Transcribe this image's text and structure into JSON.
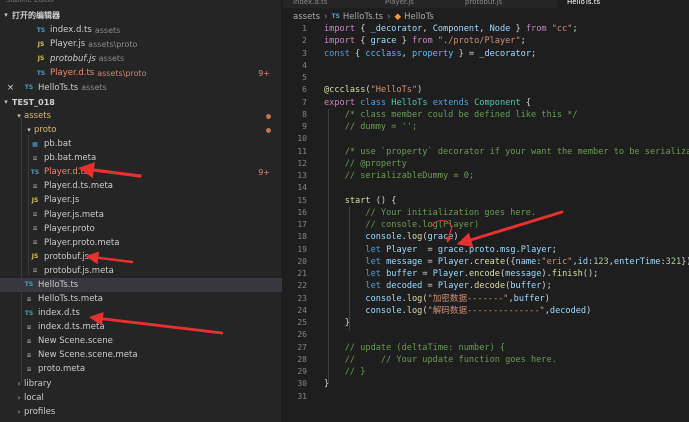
{
  "title_bar": {
    "text": "Subline Editor"
  },
  "sidebar": {
    "open_editors_label": "打开的编辑器",
    "open_editors": [
      {
        "icon": "TS",
        "name": "index.d.ts",
        "dir": "assets",
        "state": "normal"
      },
      {
        "icon": "JS",
        "name": "Player.js",
        "dir": "assets\\proto",
        "state": "normal"
      },
      {
        "icon": "JS",
        "name": "protobuf.js",
        "dir": "assets",
        "state": "normal",
        "italic": true
      },
      {
        "icon": "TS",
        "name": "Player.d.ts",
        "dir": "assets\\proto",
        "state": "error",
        "badge": "9+"
      },
      {
        "icon": "TS",
        "name": "HelloTs.ts",
        "dir": "assets",
        "state": "active",
        "close": "×"
      }
    ],
    "project_label": "TEST_018",
    "tree": [
      {
        "indent": 1,
        "type": "folder",
        "name": "assets",
        "open": true,
        "state": "modified",
        "dot": true
      },
      {
        "indent": 2,
        "type": "folder",
        "name": "proto",
        "open": true,
        "state": "modified",
        "dot": true
      },
      {
        "indent": 3,
        "type": "file",
        "icon": "BAT",
        "name": "pb.bat"
      },
      {
        "indent": 3,
        "type": "file",
        "icon": "META",
        "name": "pb.bat.meta"
      },
      {
        "indent": 3,
        "type": "file",
        "icon": "TS",
        "name": "Player.d.ts",
        "state": "error",
        "badge": "9+"
      },
      {
        "indent": 3,
        "type": "file",
        "icon": "META",
        "name": "Player.d.ts.meta"
      },
      {
        "indent": 3,
        "type": "file",
        "icon": "JS",
        "name": "Player.js"
      },
      {
        "indent": 3,
        "type": "file",
        "icon": "META",
        "name": "Player.js.meta"
      },
      {
        "indent": 3,
        "type": "file",
        "icon": "PROTO",
        "name": "Player.proto"
      },
      {
        "indent": 3,
        "type": "file",
        "icon": "META",
        "name": "Player.proto.meta"
      },
      {
        "indent": 3,
        "type": "file",
        "icon": "JS",
        "name": "protobuf.js"
      },
      {
        "indent": 3,
        "type": "file",
        "icon": "META",
        "name": "protobuf.js.meta"
      },
      {
        "indent": 2,
        "type": "file",
        "icon": "TS",
        "name": "HelloTs.ts",
        "selected": true
      },
      {
        "indent": 2,
        "type": "file",
        "icon": "META",
        "name": "HelloTs.ts.meta"
      },
      {
        "indent": 2,
        "type": "file",
        "icon": "TS",
        "name": "index.d.ts"
      },
      {
        "indent": 2,
        "type": "file",
        "icon": "META",
        "name": "index.d.ts.meta"
      },
      {
        "indent": 2,
        "type": "file",
        "icon": "SCENE",
        "name": "New Scene.scene"
      },
      {
        "indent": 2,
        "type": "file",
        "icon": "META",
        "name": "New Scene.scene.meta"
      },
      {
        "indent": 2,
        "type": "file",
        "icon": "META",
        "name": "proto.meta"
      },
      {
        "indent": 1,
        "type": "folder",
        "name": "library",
        "open": false
      },
      {
        "indent": 1,
        "type": "folder",
        "name": "local",
        "open": false
      },
      {
        "indent": 1,
        "type": "folder",
        "name": "profiles",
        "open": false
      }
    ]
  },
  "tabs": [
    {
      "label": "index.d.ts",
      "active": false
    },
    {
      "label": "Player.js",
      "active": false
    },
    {
      "label": "protobuf.js",
      "active": false
    },
    {
      "label": "HelloTs.ts",
      "active": true
    }
  ],
  "breadcrumb": {
    "folder": "assets",
    "file": "HelloTs.ts",
    "symbol": "HelloTs"
  },
  "code_lines": [
    [
      [
        "k",
        "import"
      ],
      [
        "p",
        " { "
      ],
      [
        "v",
        "_decorator"
      ],
      [
        "p",
        ", "
      ],
      [
        "v",
        "Component"
      ],
      [
        "p",
        ", "
      ],
      [
        "v",
        "Node"
      ],
      [
        "p",
        " } "
      ],
      [
        "k",
        "from"
      ],
      [
        "p",
        " "
      ],
      [
        "s",
        "\"cc\""
      ],
      [
        "p",
        ";"
      ]
    ],
    [
      [
        "k",
        "import"
      ],
      [
        "p",
        " { "
      ],
      [
        "v",
        "grace"
      ],
      [
        "p",
        " } "
      ],
      [
        "k",
        "from"
      ],
      [
        "p",
        " "
      ],
      [
        "s",
        "\"./proto/Player\""
      ],
      [
        "p",
        ";"
      ]
    ],
    [
      [
        "b",
        "const"
      ],
      [
        "p",
        " { "
      ],
      [
        "c",
        "ccclass"
      ],
      [
        "p",
        ", "
      ],
      [
        "c",
        "property"
      ],
      [
        "p",
        " } = "
      ],
      [
        "v",
        "_decorator"
      ],
      [
        "p",
        ";"
      ]
    ],
    [],
    [],
    [
      [
        "f",
        "@ccclass"
      ],
      [
        "p",
        "("
      ],
      [
        "s",
        "\"HelloTs\""
      ],
      [
        "p",
        ")"
      ]
    ],
    [
      [
        "k",
        "export"
      ],
      [
        "p",
        " "
      ],
      [
        "b",
        "class"
      ],
      [
        "p",
        " "
      ],
      [
        "t",
        "HelloTs"
      ],
      [
        "p",
        " "
      ],
      [
        "b",
        "extends"
      ],
      [
        "p",
        " "
      ],
      [
        "t",
        "Component"
      ],
      [
        "p",
        " {"
      ]
    ],
    [
      [
        "cm",
        "    /* class member could be defined like this */"
      ]
    ],
    [
      [
        "cm",
        "    // dummy = '';"
      ]
    ],
    [],
    [
      [
        "cm",
        "    /* use `property` decorator if your want the member to be serializable */"
      ]
    ],
    [
      [
        "cm",
        "    // @property"
      ]
    ],
    [
      [
        "cm",
        "    // serializableDummy = 0;"
      ]
    ],
    [],
    [
      [
        "p",
        "    "
      ],
      [
        "f",
        "start"
      ],
      [
        "p",
        " () {"
      ]
    ],
    [
      [
        "cm",
        "        // Your initialization goes here."
      ]
    ],
    [
      [
        "cm",
        "        // console.log(Player)"
      ]
    ],
    [
      [
        "p",
        "        "
      ],
      [
        "v",
        "console"
      ],
      [
        "p",
        "."
      ],
      [
        "f",
        "log"
      ],
      [
        "p",
        "("
      ],
      [
        "v",
        "grace"
      ],
      [
        "p",
        ")"
      ]
    ],
    [
      [
        "p",
        "        "
      ],
      [
        "b",
        "let"
      ],
      [
        "p",
        " "
      ],
      [
        "v",
        "Player"
      ],
      [
        "p",
        "  = "
      ],
      [
        "v",
        "grace"
      ],
      [
        "p",
        "."
      ],
      [
        "v",
        "proto"
      ],
      [
        "p",
        "."
      ],
      [
        "v",
        "msg"
      ],
      [
        "p",
        "."
      ],
      [
        "v",
        "Player"
      ],
      [
        "p",
        ";"
      ]
    ],
    [
      [
        "p",
        "        "
      ],
      [
        "b",
        "let"
      ],
      [
        "p",
        " "
      ],
      [
        "v",
        "message"
      ],
      [
        "p",
        " = "
      ],
      [
        "v",
        "Player"
      ],
      [
        "p",
        "."
      ],
      [
        "f",
        "create"
      ],
      [
        "p",
        "({"
      ],
      [
        "v",
        "name"
      ],
      [
        "p",
        ":"
      ],
      [
        "s",
        "\"eric\""
      ],
      [
        "p",
        ","
      ],
      [
        "v",
        "id"
      ],
      [
        "p",
        ":"
      ],
      [
        "n",
        "123"
      ],
      [
        "p",
        ","
      ],
      [
        "v",
        "enterTime"
      ],
      [
        "p",
        ":"
      ],
      [
        "n",
        "321"
      ],
      [
        "p",
        "});"
      ]
    ],
    [
      [
        "p",
        "        "
      ],
      [
        "b",
        "let"
      ],
      [
        "p",
        " "
      ],
      [
        "v",
        "buffer"
      ],
      [
        "p",
        " = "
      ],
      [
        "v",
        "Player"
      ],
      [
        "p",
        "."
      ],
      [
        "f",
        "encode"
      ],
      [
        "p",
        "("
      ],
      [
        "v",
        "message"
      ],
      [
        "p",
        ")."
      ],
      [
        "f",
        "finish"
      ],
      [
        "p",
        "();"
      ]
    ],
    [
      [
        "p",
        "        "
      ],
      [
        "b",
        "let"
      ],
      [
        "p",
        " "
      ],
      [
        "v",
        "decoded"
      ],
      [
        "p",
        " = "
      ],
      [
        "v",
        "Player"
      ],
      [
        "p",
        "."
      ],
      [
        "f",
        "decode"
      ],
      [
        "p",
        "("
      ],
      [
        "v",
        "buffer"
      ],
      [
        "p",
        ");"
      ]
    ],
    [
      [
        "p",
        "        "
      ],
      [
        "v",
        "console"
      ],
      [
        "p",
        "."
      ],
      [
        "f",
        "log"
      ],
      [
        "p",
        "("
      ],
      [
        "s",
        "\"加密数据-------\""
      ],
      [
        "p",
        ","
      ],
      [
        "v",
        "buffer"
      ],
      [
        "p",
        ")"
      ]
    ],
    [
      [
        "p",
        "        "
      ],
      [
        "v",
        "console"
      ],
      [
        "p",
        "."
      ],
      [
        "f",
        "log"
      ],
      [
        "p",
        "("
      ],
      [
        "s",
        "\"解码数据--------------\""
      ],
      [
        "p",
        ","
      ],
      [
        "v",
        "decoded"
      ],
      [
        "p",
        ")"
      ]
    ],
    [
      [
        "p",
        "    }"
      ]
    ],
    [],
    [
      [
        "cm",
        "    // update (deltaTime: number) {"
      ]
    ],
    [
      [
        "cm",
        "    //     // Your update function goes here."
      ]
    ],
    [
      [
        "cm",
        "    // }"
      ]
    ],
    [
      [
        "p",
        "}"
      ]
    ],
    []
  ],
  "colors": {
    "annotation_arrow": "#e8312f",
    "ts_icon": "#519aba",
    "js_icon": "#cbcb41"
  }
}
